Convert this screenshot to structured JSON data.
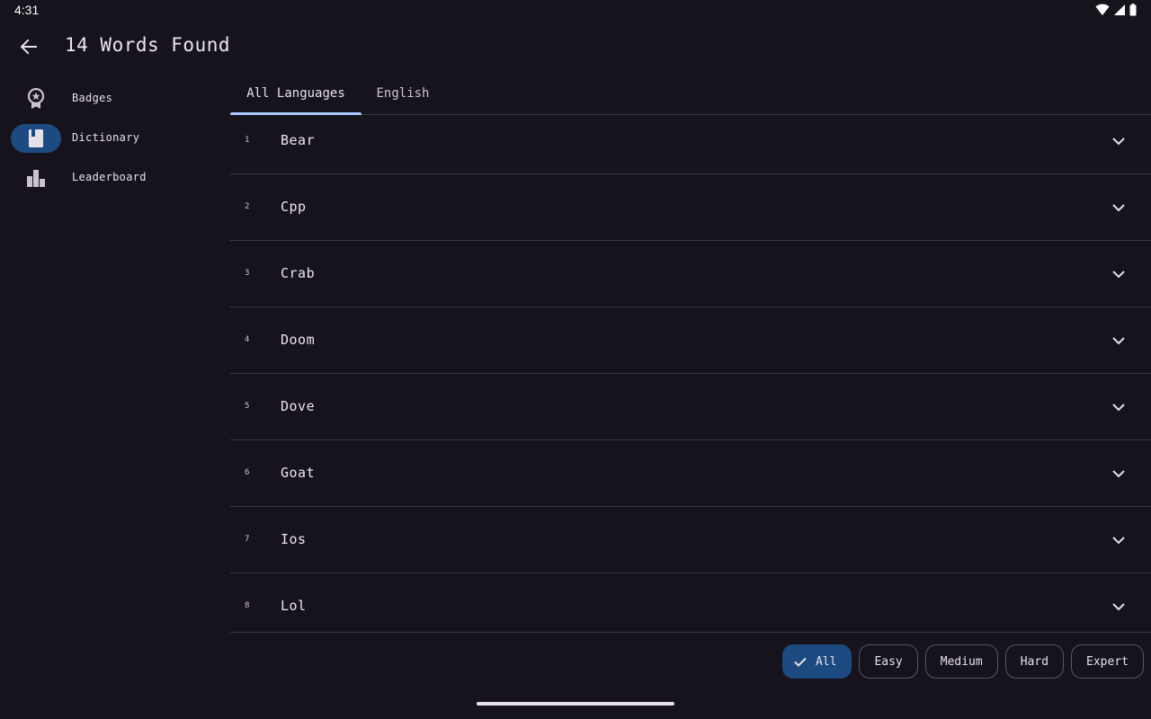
{
  "status": {
    "time": "4:31"
  },
  "app_bar": {
    "title": "14 Words Found"
  },
  "nav": {
    "items": [
      {
        "label": "Badges",
        "icon": "badge-icon",
        "active": false
      },
      {
        "label": "Dictionary",
        "icon": "book-icon",
        "active": true
      },
      {
        "label": "Leaderboard",
        "icon": "leaderboard-icon",
        "active": false
      }
    ]
  },
  "tabs": {
    "all": "All Languages",
    "english": "English"
  },
  "words": [
    {
      "index": "1",
      "word": "Bear"
    },
    {
      "index": "2",
      "word": "Cpp"
    },
    {
      "index": "3",
      "word": "Crab"
    },
    {
      "index": "4",
      "word": "Doom"
    },
    {
      "index": "5",
      "word": "Dove"
    },
    {
      "index": "6",
      "word": "Goat"
    },
    {
      "index": "7",
      "word": "Ios"
    },
    {
      "index": "8",
      "word": "Lol"
    }
  ],
  "filters": {
    "all": "All",
    "easy": "Easy",
    "medium": "Medium",
    "hard": "Hard",
    "expert": "Expert"
  },
  "colors": {
    "background": "#16131c",
    "accent": "#1d4a80",
    "tab_indicator": "#a7c8ff"
  }
}
